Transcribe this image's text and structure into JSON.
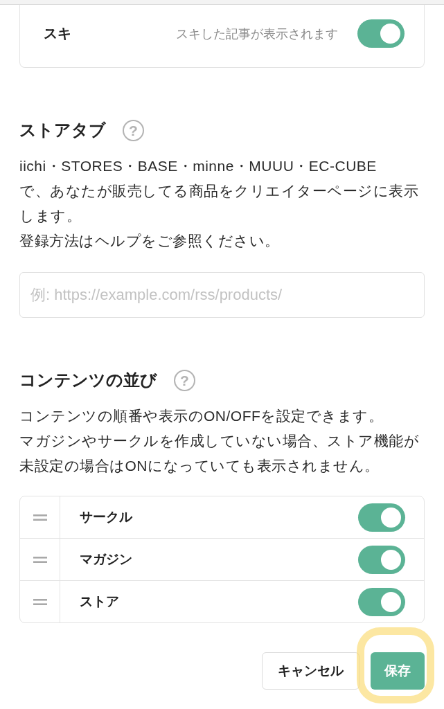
{
  "like_card": {
    "label": "スキ",
    "description": "スキした記事が表示されます",
    "on": true
  },
  "store_tab": {
    "heading": "ストアタブ",
    "help_icon": "?",
    "lines": [
      "iichi・STORES・BASE・minne・MUUU・EC-CUBE",
      "で、あなたが販売してる商品をクリエイターページに表示",
      "します。",
      "登録方法はヘルプをご参照ください。"
    ],
    "input": {
      "placeholder": "例: https://example.com/rss/products/"
    }
  },
  "content_order": {
    "heading": "コンテンツの並び",
    "help_icon": "?",
    "lines": [
      "コンテンツの順番や表示のON/OFFを設定できます。",
      "マガジンやサークルを作成していない場合、ストア機能が",
      "未設定の場合はONになっていても表示されません。"
    ],
    "items": [
      {
        "label": "サークル",
        "on": true
      },
      {
        "label": "マガジン",
        "on": true
      },
      {
        "label": "ストア",
        "on": true
      }
    ]
  },
  "buttons": [
    {
      "label": "キャンセル",
      "kind": "secondary",
      "highlighted": false
    },
    {
      "label": "保存",
      "kind": "primary",
      "highlighted": true
    }
  ]
}
